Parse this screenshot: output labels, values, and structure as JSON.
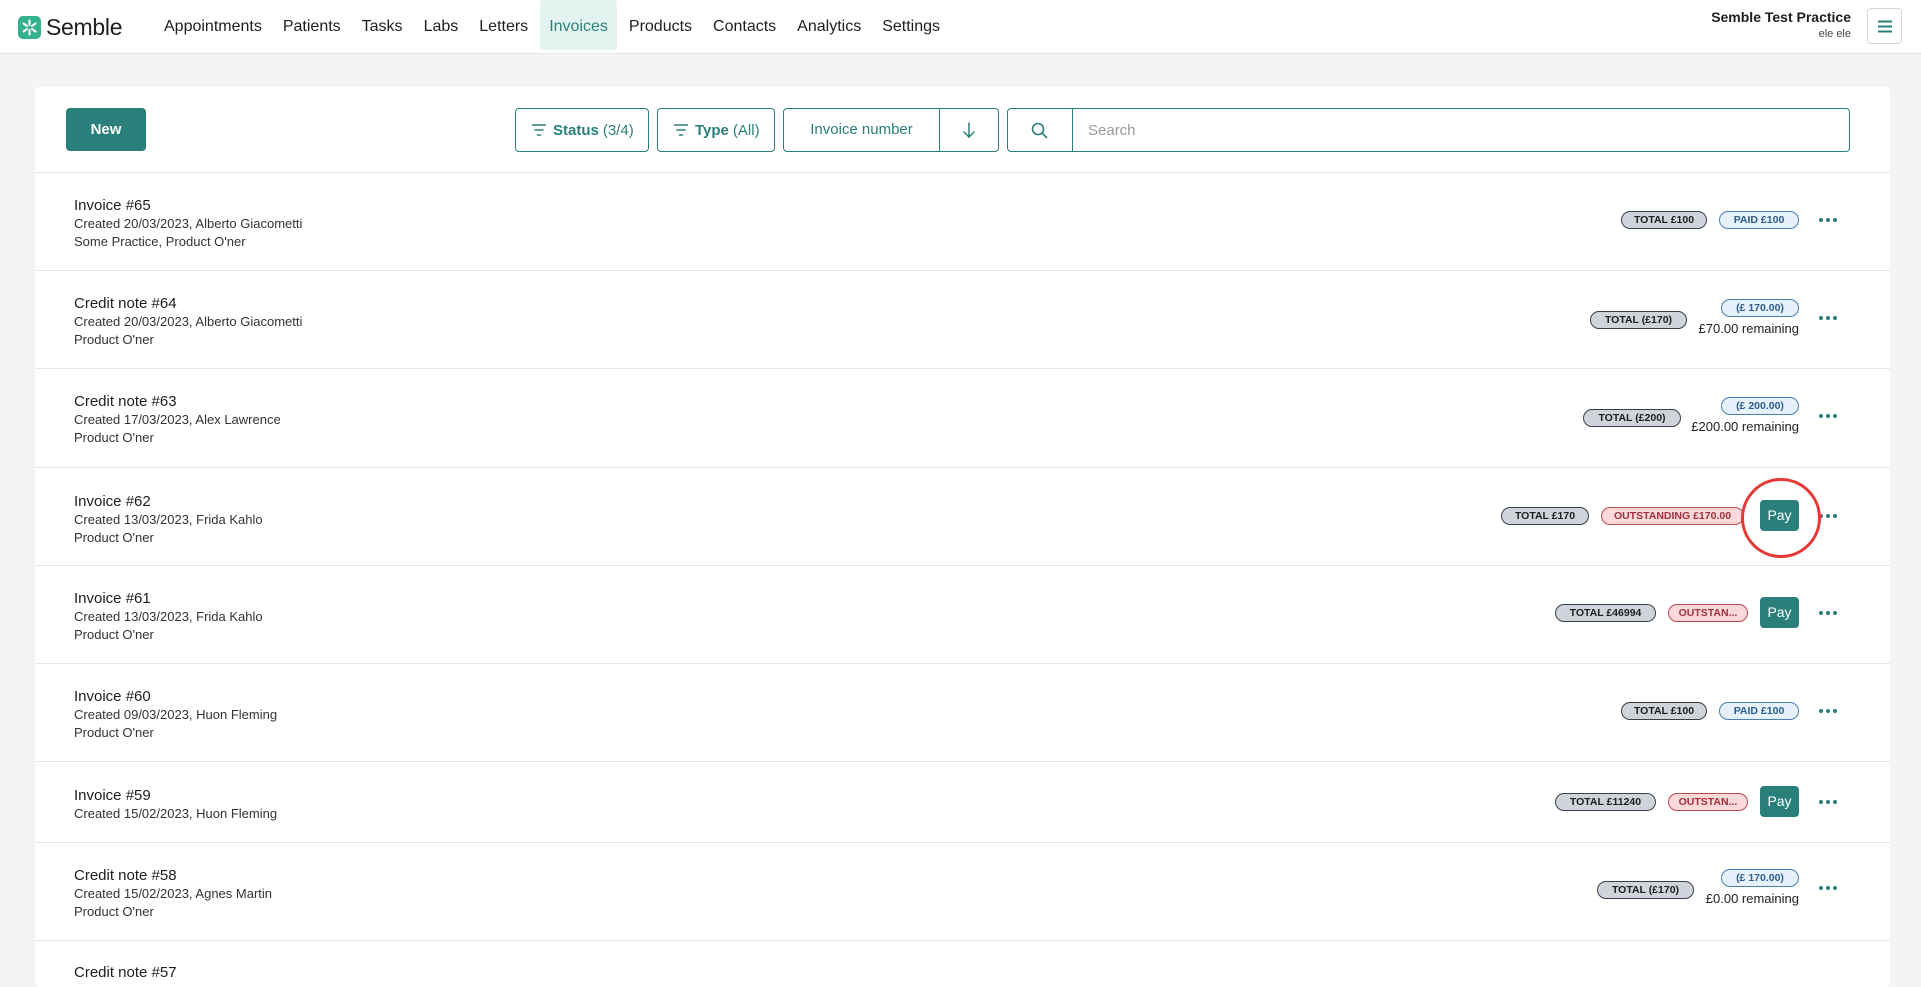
{
  "app": {
    "name": "Semble",
    "brand_color": "#34b18e",
    "accent_color": "#2a7f7a"
  },
  "nav": {
    "items": [
      {
        "label": "Appointments"
      },
      {
        "label": "Patients"
      },
      {
        "label": "Tasks"
      },
      {
        "label": "Labs"
      },
      {
        "label": "Letters"
      },
      {
        "label": "Invoices"
      },
      {
        "label": "Products"
      },
      {
        "label": "Contacts"
      },
      {
        "label": "Analytics"
      },
      {
        "label": "Settings"
      }
    ],
    "active": "Invoices"
  },
  "account": {
    "practice": "Semble Test Practice",
    "user": "ele ele"
  },
  "toolbar": {
    "new_label": "New",
    "status_filter": {
      "label": "Status",
      "count": "(3/4)"
    },
    "type_filter": {
      "label": "Type",
      "count": "(All)"
    },
    "sort_field": "Invoice number",
    "search_placeholder": "Search"
  },
  "rows": [
    {
      "title": "Invoice #65",
      "line1": "Created 20/03/2023, Alberto Giacometti",
      "line2": "Some Practice, Product O'ner",
      "total": "TOTAL £100",
      "status": "PAID £100"
    },
    {
      "title": "Credit note #64",
      "line1": "Created 20/03/2023, Alberto Giacometti",
      "line2": "Product O'ner",
      "total": "TOTAL (£170)",
      "status": "(£ 170.00)",
      "remaining": "£70.00 remaining"
    },
    {
      "title": "Credit note #63",
      "line1": "Created 17/03/2023, Alex Lawrence",
      "line2": "Product O'ner",
      "total": "TOTAL (£200)",
      "status": "(£ 200.00)",
      "remaining": "£200.00 remaining"
    },
    {
      "title": "Invoice #62",
      "line1": "Created 13/03/2023, Frida Kahlo",
      "line2": "Product O'ner",
      "total": "TOTAL £170",
      "status": "OUTSTANDING £170.00",
      "action": "Pay"
    },
    {
      "title": "Invoice #61",
      "line1": "Created 13/03/2023, Frida Kahlo",
      "line2": "Product O'ner",
      "total": "TOTAL £46994",
      "status": "OUTSTAN...",
      "action": "Pay"
    },
    {
      "title": "Invoice #60",
      "line1": "Created 09/03/2023, Huon Fleming",
      "line2": "Product O'ner",
      "total": "TOTAL £100",
      "status": "PAID £100"
    },
    {
      "title": "Invoice #59",
      "line1": "Created 15/02/2023, Huon Fleming",
      "total": "TOTAL £11240",
      "status": "OUTSTAN...",
      "action": "Pay"
    },
    {
      "title": "Credit note #58",
      "line1": "Created 15/02/2023, Agnes Martin",
      "line2": "Product O'ner",
      "total": "TOTAL (£170)",
      "status": "(£ 170.00)",
      "remaining": "£0.00 remaining"
    },
    {
      "title": "Credit note #57"
    }
  ]
}
